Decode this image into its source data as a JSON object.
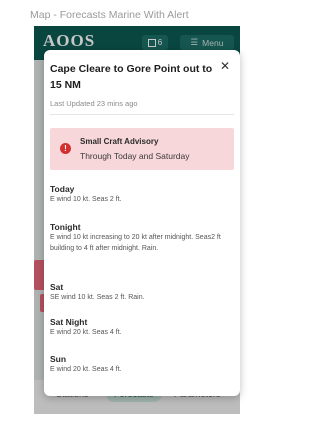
{
  "caption": "Map - Forecasts Marine With Alert",
  "app": {
    "logo": "AOOS",
    "badge_count": "6",
    "menu_label": "Menu"
  },
  "bottom_nav": {
    "tabs": [
      {
        "label": "Stations"
      },
      {
        "label": "Forecasts",
        "active": true
      },
      {
        "label": "Parameters"
      }
    ]
  },
  "modal": {
    "title": "Cape Cleare to Gore Point out to 15 NM",
    "updated": "Last Updated 23 mins ago",
    "advisory": {
      "title": "Small Craft Advisory",
      "subtitle": "Through Today and Saturday",
      "icon": "alert-icon"
    },
    "periods": [
      {
        "name": "Today",
        "text": "E wind 10 kt. Seas 2 ft."
      },
      {
        "name": "Tonight",
        "text": "E wind 10 kt increasing to 20 kt after midnight. Seas2 ft building to 4 ft after midnight. Rain."
      },
      {
        "name": "Sat",
        "text": "SE wind 10 kt. Seas 2 ft. Rain."
      },
      {
        "name": "Sat Night",
        "text": "E wind 20 kt. Seas 4 ft."
      },
      {
        "name": "Sun",
        "text": "E wind 20 kt. Seas 4 ft."
      }
    ]
  },
  "colors": {
    "appbar": "#0e5a53",
    "advisory_bg": "#f8d7da",
    "advisory_icon": "#d32f2f"
  }
}
